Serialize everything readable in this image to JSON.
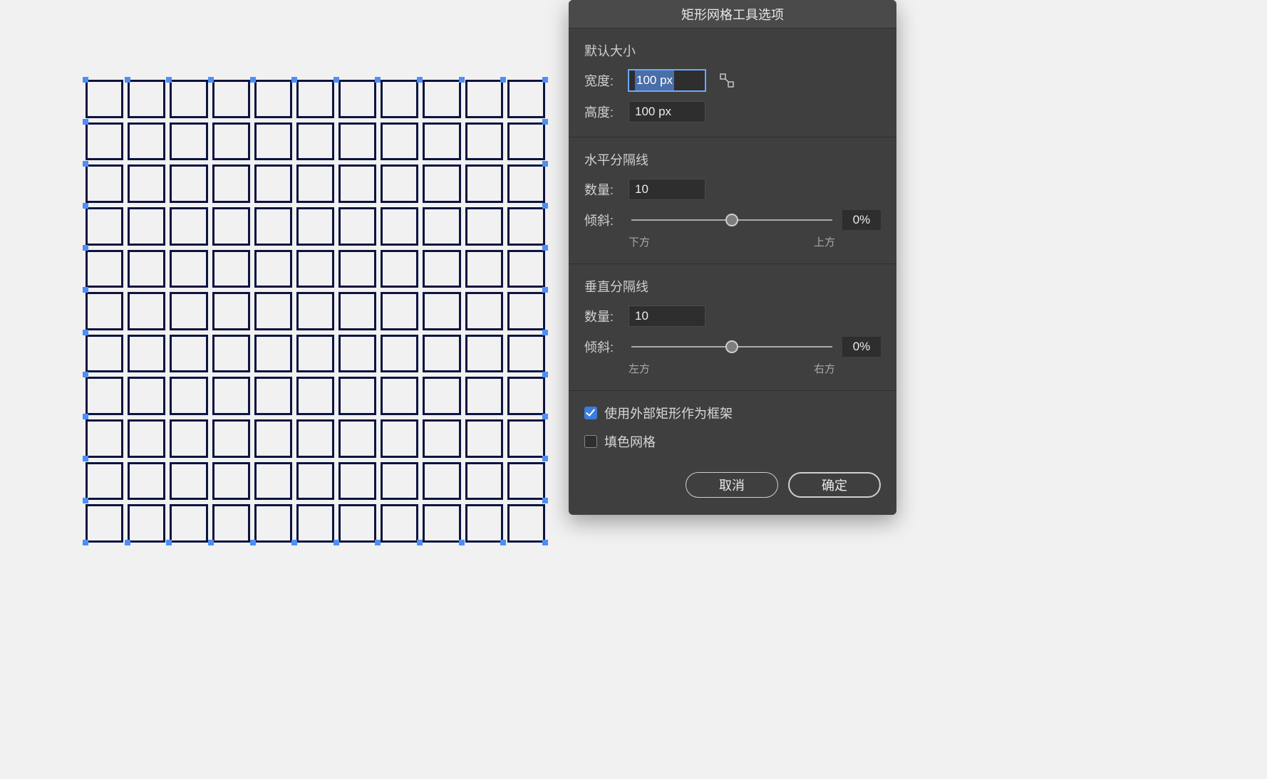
{
  "dialog": {
    "title": "矩形网格工具选项",
    "default_size": {
      "section_title": "默认大小",
      "width_label": "宽度:",
      "width_value": "100 px",
      "height_label": "高度:",
      "height_value": "100 px"
    },
    "horizontal_dividers": {
      "section_title": "水平分隔线",
      "count_label": "数量:",
      "count_value": "10",
      "skew_label": "倾斜:",
      "skew_value": "0%",
      "skew_left_label": "下方",
      "skew_right_label": "上方"
    },
    "vertical_dividers": {
      "section_title": "垂直分隔线",
      "count_label": "数量:",
      "count_value": "10",
      "skew_label": "倾斜:",
      "skew_value": "0%",
      "skew_left_label": "左方",
      "skew_right_label": "右方"
    },
    "use_outer_rect_label": "使用外部矩形作为框架",
    "fill_grid_label": "填色网格",
    "cancel_label": "取消",
    "ok_label": "确定"
  },
  "grid_preview": {
    "rows": 11,
    "cols": 11
  }
}
